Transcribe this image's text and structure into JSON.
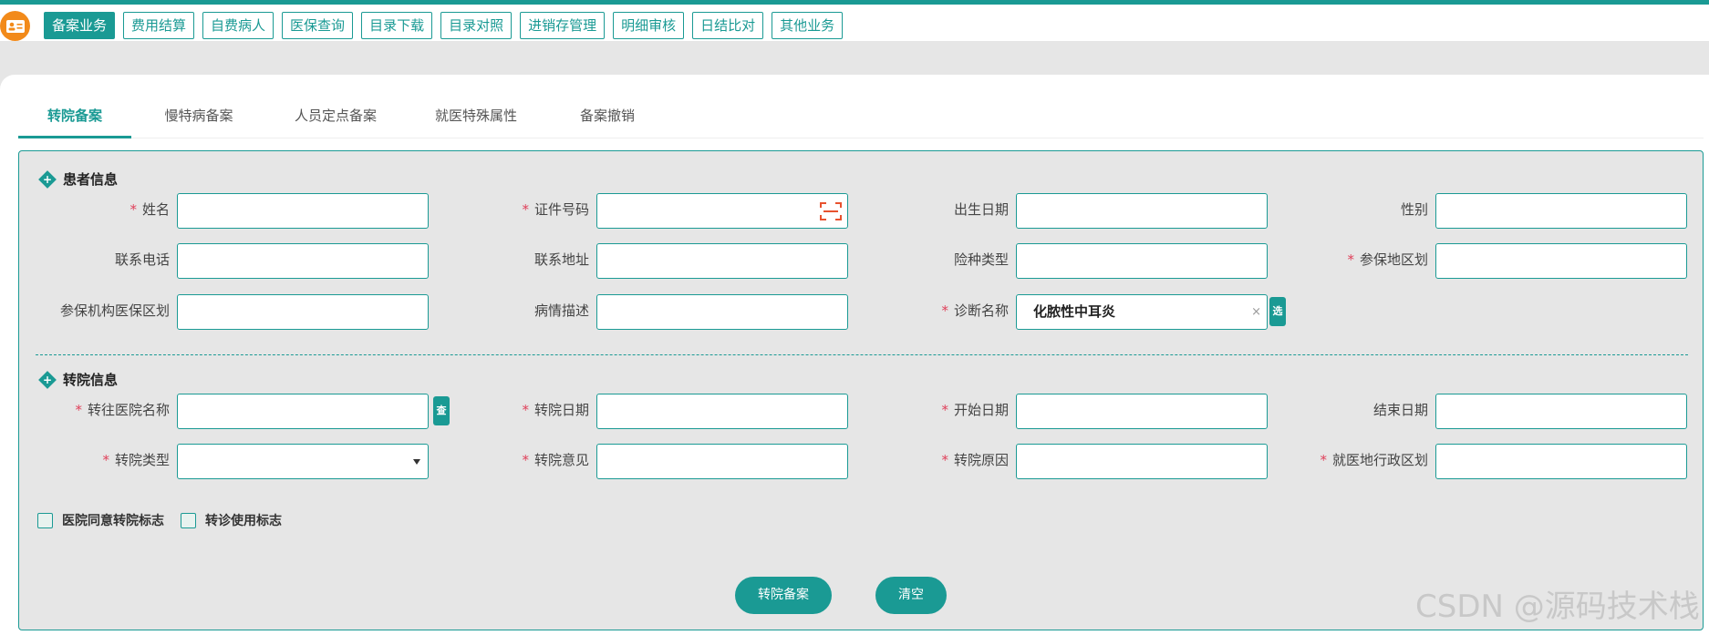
{
  "nav": {
    "items": [
      "备案业务",
      "费用结算",
      "自费病人",
      "医保查询",
      "目录下载",
      "目录对照",
      "进销存管理",
      "明细审核",
      "日结比对",
      "其他业务"
    ],
    "active_index": 0
  },
  "tabs": {
    "items": [
      "转院备案",
      "慢特病备案",
      "人员定点备案",
      "就医特殊属性",
      "备案撤销"
    ],
    "active_index": 0
  },
  "patient_section": {
    "title": "患者信息",
    "fields": {
      "name": {
        "label": "姓名",
        "value": "",
        "required": true
      },
      "id_number": {
        "label": "证件号码",
        "value": "",
        "required": true
      },
      "birth_date": {
        "label": "出生日期",
        "value": ""
      },
      "gender": {
        "label": "性别",
        "value": ""
      },
      "phone": {
        "label": "联系电话",
        "value": ""
      },
      "address": {
        "label": "联系地址",
        "value": ""
      },
      "insurance_type": {
        "label": "险种类型",
        "value": ""
      },
      "insured_region": {
        "label": "参保地区划",
        "value": "",
        "required": true
      },
      "agency_region": {
        "label": "参保机构医保区划",
        "value": ""
      },
      "condition_desc": {
        "label": "病情描述",
        "value": ""
      },
      "diagnosis": {
        "label": "诊断名称",
        "value": "化脓性中耳炎",
        "required": true,
        "clear_icon": "×",
        "pick_label": "选"
      }
    }
  },
  "transfer_section": {
    "title": "转院信息",
    "fields": {
      "target_hospital": {
        "label": "转往医院名称",
        "value": "",
        "required": true,
        "search_label": "查"
      },
      "transfer_date": {
        "label": "转院日期",
        "value": "",
        "required": true
      },
      "start_date": {
        "label": "开始日期",
        "value": "",
        "required": true
      },
      "end_date": {
        "label": "结束日期",
        "value": ""
      },
      "transfer_type": {
        "label": "转院类型",
        "value": "",
        "required": true
      },
      "transfer_opinion": {
        "label": "转院意见",
        "value": "",
        "required": true
      },
      "transfer_reason": {
        "label": "转院原因",
        "value": "",
        "required": true
      },
      "admin_region": {
        "label": "就医地行政区划",
        "value": "",
        "required": true
      }
    },
    "checkboxes": [
      "医院同意转院标志",
      "转诊使用标志"
    ]
  },
  "actions": {
    "submit": "转院备案",
    "clear": "清空"
  },
  "watermark": "CSDN @源码技术栈",
  "colors": {
    "primary": "#1a9a94",
    "required": "#e0405a",
    "logo": "#f28a1a",
    "scan_icon": "#e8522f"
  }
}
